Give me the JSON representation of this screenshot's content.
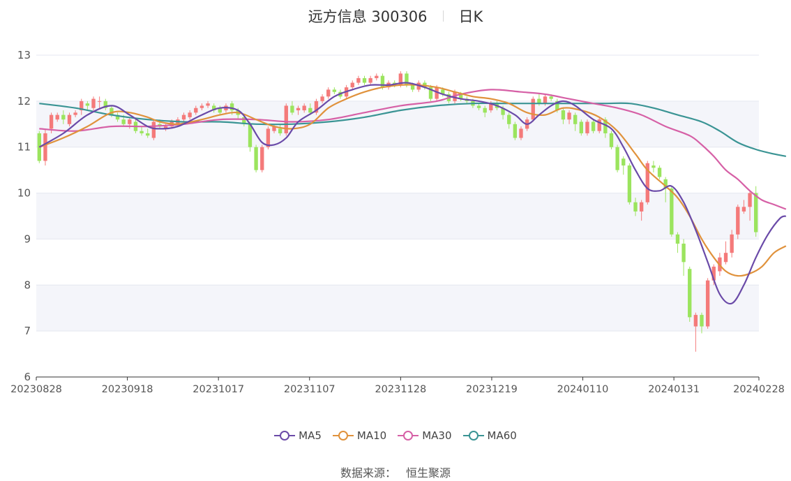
{
  "header": {
    "stock": "远方信息 300306",
    "period": "日K"
  },
  "source": {
    "label": "数据来源：",
    "value": "恒生聚源"
  },
  "colors": {
    "up": "#f47a7a",
    "down": "#9be45e",
    "ma5": "#6a4aa8",
    "ma10": "#e0923c",
    "ma30": "#d660a6",
    "ma60": "#3a9494",
    "grid_band": "#f4f5fa",
    "grid_line": "#e4e7f0"
  },
  "chart_data": {
    "type": "candlestick",
    "ylim": [
      6,
      13
    ],
    "yticks": [
      6,
      7,
      8,
      9,
      10,
      11,
      12,
      13
    ],
    "xticks": [
      "20230828",
      "20230918",
      "20231017",
      "20231107",
      "20231128",
      "20231219",
      "20240110",
      "20240131",
      "20240228"
    ],
    "xtick_index": [
      0,
      15,
      30,
      45,
      60,
      75,
      90,
      105,
      119
    ],
    "legend": [
      {
        "key": "ma5",
        "name": "MA5"
      },
      {
        "key": "ma10",
        "name": "MA10"
      },
      {
        "key": "ma30",
        "name": "MA30"
      },
      {
        "key": "ma60",
        "name": "MA60"
      }
    ],
    "candles": [
      [
        11.3,
        10.7,
        11.35,
        10.65
      ],
      [
        10.7,
        11.3,
        11.4,
        10.6
      ],
      [
        11.4,
        11.7,
        11.75,
        11.3
      ],
      [
        11.6,
        11.7,
        11.75,
        11.55
      ],
      [
        11.7,
        11.6,
        11.8,
        11.5
      ],
      [
        11.5,
        11.7,
        11.75,
        11.45
      ],
      [
        11.7,
        11.75,
        11.8,
        11.65
      ],
      [
        11.8,
        12.0,
        12.05,
        11.7
      ],
      [
        11.95,
        11.9,
        12.0,
        11.8
      ],
      [
        11.85,
        12.05,
        12.1,
        11.8
      ],
      [
        12.0,
        12.0,
        12.1,
        11.85
      ],
      [
        12.0,
        11.85,
        12.05,
        11.8
      ],
      [
        11.85,
        11.7,
        11.9,
        11.65
      ],
      [
        11.7,
        11.6,
        11.75,
        11.55
      ],
      [
        11.6,
        11.5,
        11.7,
        11.45
      ],
      [
        11.5,
        11.6,
        11.65,
        11.4
      ],
      [
        11.55,
        11.35,
        11.6,
        11.3
      ],
      [
        11.35,
        11.3,
        11.45,
        11.25
      ],
      [
        11.3,
        11.25,
        11.4,
        11.2
      ],
      [
        11.2,
        11.55,
        11.6,
        11.15
      ],
      [
        11.5,
        11.45,
        11.6,
        11.4
      ],
      [
        11.4,
        11.45,
        11.5,
        11.35
      ],
      [
        11.45,
        11.55,
        11.6,
        11.4
      ],
      [
        11.5,
        11.6,
        11.65,
        11.45
      ],
      [
        11.6,
        11.7,
        11.75,
        11.55
      ],
      [
        11.65,
        11.75,
        11.8,
        11.6
      ],
      [
        11.75,
        11.85,
        11.9,
        11.7
      ],
      [
        11.85,
        11.9,
        11.95,
        11.8
      ],
      [
        11.9,
        11.95,
        12.0,
        11.85
      ],
      [
        11.9,
        11.8,
        11.95,
        11.75
      ],
      [
        11.85,
        11.75,
        11.9,
        11.7
      ],
      [
        11.8,
        11.9,
        11.95,
        11.75
      ],
      [
        11.95,
        11.8,
        12.0,
        11.7
      ],
      [
        11.8,
        11.7,
        11.85,
        11.6
      ],
      [
        11.65,
        11.5,
        11.7,
        11.45
      ],
      [
        11.5,
        11.0,
        11.55,
        10.9
      ],
      [
        11.0,
        10.5,
        11.05,
        10.45
      ],
      [
        10.5,
        11.0,
        11.05,
        10.45
      ],
      [
        11.0,
        11.4,
        11.45,
        10.95
      ],
      [
        11.35,
        11.45,
        11.5,
        11.3
      ],
      [
        11.4,
        11.3,
        11.5,
        11.25
      ],
      [
        11.3,
        11.9,
        11.95,
        11.25
      ],
      [
        11.9,
        11.75,
        12.0,
        11.7
      ],
      [
        11.8,
        11.85,
        11.9,
        11.7
      ],
      [
        11.8,
        11.9,
        11.95,
        11.75
      ],
      [
        11.85,
        11.75,
        11.95,
        11.7
      ],
      [
        11.75,
        12.0,
        12.05,
        11.7
      ],
      [
        12.0,
        12.1,
        12.15,
        11.95
      ],
      [
        12.1,
        12.25,
        12.3,
        12.05
      ],
      [
        12.25,
        12.2,
        12.3,
        12.15
      ],
      [
        12.2,
        12.1,
        12.25,
        12.05
      ],
      [
        12.1,
        12.3,
        12.35,
        12.05
      ],
      [
        12.3,
        12.4,
        12.45,
        12.25
      ],
      [
        12.4,
        12.5,
        12.55,
        12.35
      ],
      [
        12.5,
        12.4,
        12.55,
        12.35
      ],
      [
        12.4,
        12.5,
        12.55,
        12.35
      ],
      [
        12.5,
        12.55,
        12.6,
        12.45
      ],
      [
        12.55,
        12.3,
        12.6,
        12.25
      ],
      [
        12.3,
        12.4,
        12.45,
        12.25
      ],
      [
        12.4,
        12.35,
        12.45,
        12.3
      ],
      [
        12.35,
        12.6,
        12.65,
        12.3
      ],
      [
        12.6,
        12.35,
        12.65,
        12.3
      ],
      [
        12.35,
        12.25,
        12.4,
        12.2
      ],
      [
        12.25,
        12.4,
        12.45,
        12.2
      ],
      [
        12.4,
        12.3,
        12.45,
        12.25
      ],
      [
        12.3,
        12.05,
        12.35,
        12.0
      ],
      [
        12.05,
        12.3,
        12.35,
        12.0
      ],
      [
        12.25,
        12.15,
        12.3,
        12.1
      ],
      [
        12.15,
        12.0,
        12.2,
        11.95
      ],
      [
        12.0,
        12.2,
        12.25,
        11.95
      ],
      [
        12.15,
        12.05,
        12.2,
        12.0
      ],
      [
        12.05,
        12.0,
        12.1,
        11.95
      ],
      [
        12.0,
        11.9,
        12.05,
        11.85
      ],
      [
        11.9,
        11.85,
        11.95,
        11.8
      ],
      [
        11.85,
        11.75,
        11.9,
        11.65
      ],
      [
        11.8,
        11.95,
        12.0,
        11.75
      ],
      [
        11.95,
        11.85,
        12.0,
        11.8
      ],
      [
        11.85,
        11.7,
        11.9,
        11.6
      ],
      [
        11.7,
        11.5,
        11.75,
        11.4
      ],
      [
        11.5,
        11.2,
        11.55,
        11.15
      ],
      [
        11.2,
        11.4,
        11.45,
        11.15
      ],
      [
        11.4,
        11.6,
        11.65,
        11.35
      ],
      [
        11.6,
        12.05,
        12.1,
        11.55
      ],
      [
        12.05,
        11.95,
        12.15,
        11.9
      ],
      [
        11.95,
        12.1,
        12.15,
        11.9
      ],
      [
        12.1,
        12.05,
        12.15,
        12.0
      ],
      [
        12.0,
        11.8,
        12.05,
        11.75
      ],
      [
        11.8,
        11.6,
        11.85,
        11.5
      ],
      [
        11.6,
        11.75,
        11.8,
        11.5
      ],
      [
        11.7,
        11.5,
        11.75,
        11.35
      ],
      [
        11.55,
        11.3,
        11.6,
        11.25
      ],
      [
        11.3,
        11.55,
        11.6,
        11.25
      ],
      [
        11.55,
        11.35,
        11.6,
        11.3
      ],
      [
        11.35,
        11.6,
        11.65,
        11.3
      ],
      [
        11.6,
        11.3,
        11.65,
        11.2
      ],
      [
        11.3,
        11.0,
        11.35,
        10.95
      ],
      [
        11.0,
        10.5,
        11.05,
        10.45
      ],
      [
        10.75,
        10.6,
        10.8,
        10.4
      ],
      [
        10.6,
        9.8,
        10.65,
        9.75
      ],
      [
        9.8,
        9.6,
        9.9,
        9.5
      ],
      [
        9.6,
        9.8,
        9.85,
        9.4
      ],
      [
        9.8,
        10.65,
        10.7,
        9.75
      ],
      [
        10.6,
        10.55,
        10.7,
        10.45
      ],
      [
        10.55,
        10.35,
        10.6,
        10.3
      ],
      [
        10.3,
        10.1,
        10.35,
        9.8
      ],
      [
        10.1,
        9.1,
        10.15,
        9.05
      ],
      [
        9.1,
        8.9,
        9.15,
        8.7
      ],
      [
        8.9,
        8.5,
        9.0,
        8.2
      ],
      [
        8.35,
        7.3,
        8.4,
        7.2
      ],
      [
        7.1,
        7.35,
        7.4,
        6.55
      ],
      [
        7.35,
        7.1,
        7.4,
        6.95
      ],
      [
        7.1,
        8.1,
        8.15,
        7.05
      ],
      [
        8.1,
        8.4,
        8.45,
        8.0
      ],
      [
        8.3,
        8.6,
        8.7,
        8.2
      ],
      [
        8.5,
        8.7,
        8.95,
        8.45
      ],
      [
        8.7,
        9.1,
        9.2,
        8.6
      ],
      [
        9.1,
        9.7,
        9.75,
        9.0
      ],
      [
        9.6,
        9.7,
        9.85,
        9.55
      ],
      [
        9.7,
        10.0,
        10.05,
        9.4
      ],
      [
        10.0,
        9.15,
        10.15,
        9.05
      ]
    ],
    "ma5": [
      [
        0,
        11.0
      ],
      [
        4,
        11.3
      ],
      [
        8,
        11.7
      ],
      [
        12,
        11.9
      ],
      [
        15,
        11.7
      ],
      [
        18,
        11.45
      ],
      [
        20,
        11.4
      ],
      [
        23,
        11.45
      ],
      [
        27,
        11.7
      ],
      [
        30,
        11.85
      ],
      [
        33,
        11.8
      ],
      [
        35,
        11.5
      ],
      [
        37,
        11.1
      ],
      [
        39,
        11.05
      ],
      [
        41,
        11.2
      ],
      [
        43,
        11.55
      ],
      [
        46,
        11.8
      ],
      [
        49,
        12.1
      ],
      [
        52,
        12.25
      ],
      [
        55,
        12.35
      ],
      [
        58,
        12.35
      ],
      [
        61,
        12.4
      ],
      [
        64,
        12.3
      ],
      [
        67,
        12.15
      ],
      [
        70,
        12.05
      ],
      [
        73,
        12.0
      ],
      [
        76,
        11.9
      ],
      [
        79,
        11.7
      ],
      [
        81,
        11.5
      ],
      [
        83,
        11.7
      ],
      [
        85,
        11.9
      ],
      [
        87,
        12.0
      ],
      [
        89,
        11.9
      ],
      [
        92,
        11.6
      ],
      [
        95,
        11.4
      ],
      [
        97,
        11.0
      ],
      [
        99,
        10.5
      ],
      [
        101,
        10.1
      ],
      [
        103,
        10.05
      ],
      [
        105,
        10.15
      ],
      [
        107,
        9.8
      ],
      [
        109,
        9.2
      ],
      [
        111,
        8.5
      ],
      [
        113,
        7.8
      ],
      [
        115,
        7.6
      ],
      [
        117,
        8.0
      ],
      [
        119,
        8.6
      ],
      [
        121,
        9.1
      ],
      [
        123,
        9.45
      ],
      [
        124,
        9.5
      ]
    ],
    "ma10": [
      [
        0,
        11.0
      ],
      [
        4,
        11.2
      ],
      [
        8,
        11.45
      ],
      [
        12,
        11.75
      ],
      [
        15,
        11.75
      ],
      [
        18,
        11.65
      ],
      [
        20,
        11.55
      ],
      [
        23,
        11.5
      ],
      [
        27,
        11.6
      ],
      [
        30,
        11.7
      ],
      [
        33,
        11.75
      ],
      [
        36,
        11.6
      ],
      [
        39,
        11.45
      ],
      [
        42,
        11.4
      ],
      [
        45,
        11.5
      ],
      [
        48,
        11.85
      ],
      [
        51,
        12.05
      ],
      [
        54,
        12.2
      ],
      [
        57,
        12.3
      ],
      [
        60,
        12.35
      ],
      [
        63,
        12.35
      ],
      [
        66,
        12.3
      ],
      [
        69,
        12.2
      ],
      [
        72,
        12.1
      ],
      [
        75,
        12.05
      ],
      [
        78,
        11.95
      ],
      [
        81,
        11.75
      ],
      [
        84,
        11.7
      ],
      [
        87,
        11.85
      ],
      [
        90,
        11.8
      ],
      [
        93,
        11.65
      ],
      [
        96,
        11.35
      ],
      [
        99,
        10.85
      ],
      [
        101,
        10.5
      ],
      [
        104,
        10.15
      ],
      [
        106,
        9.9
      ],
      [
        108,
        9.5
      ],
      [
        110,
        9.0
      ],
      [
        112,
        8.6
      ],
      [
        114,
        8.3
      ],
      [
        116,
        8.2
      ],
      [
        118,
        8.25
      ],
      [
        120,
        8.4
      ],
      [
        122,
        8.7
      ],
      [
        124,
        8.85
      ]
    ],
    "ma30": [
      [
        0,
        11.4
      ],
      [
        6,
        11.35
      ],
      [
        12,
        11.45
      ],
      [
        18,
        11.45
      ],
      [
        24,
        11.5
      ],
      [
        30,
        11.6
      ],
      [
        36,
        11.6
      ],
      [
        42,
        11.55
      ],
      [
        48,
        11.6
      ],
      [
        54,
        11.75
      ],
      [
        60,
        11.9
      ],
      [
        66,
        12.0
      ],
      [
        70,
        12.15
      ],
      [
        75,
        12.25
      ],
      [
        80,
        12.2
      ],
      [
        84,
        12.15
      ],
      [
        88,
        12.05
      ],
      [
        92,
        11.95
      ],
      [
        96,
        11.85
      ],
      [
        100,
        11.7
      ],
      [
        104,
        11.45
      ],
      [
        108,
        11.25
      ],
      [
        110,
        11.05
      ],
      [
        112,
        10.8
      ],
      [
        114,
        10.5
      ],
      [
        116,
        10.3
      ],
      [
        118,
        10.05
      ],
      [
        120,
        9.85
      ],
      [
        122,
        9.75
      ],
      [
        124,
        9.65
      ]
    ],
    "ma60": [
      [
        0,
        11.95
      ],
      [
        6,
        11.85
      ],
      [
        12,
        11.7
      ],
      [
        18,
        11.6
      ],
      [
        24,
        11.55
      ],
      [
        30,
        11.55
      ],
      [
        36,
        11.5
      ],
      [
        42,
        11.5
      ],
      [
        48,
        11.55
      ],
      [
        54,
        11.65
      ],
      [
        60,
        11.8
      ],
      [
        66,
        11.9
      ],
      [
        72,
        11.95
      ],
      [
        78,
        11.95
      ],
      [
        84,
        11.95
      ],
      [
        90,
        11.95
      ],
      [
        94,
        11.95
      ],
      [
        98,
        11.95
      ],
      [
        102,
        11.85
      ],
      [
        106,
        11.7
      ],
      [
        110,
        11.55
      ],
      [
        113,
        11.35
      ],
      [
        116,
        11.1
      ],
      [
        119,
        10.95
      ],
      [
        122,
        10.85
      ],
      [
        124,
        10.8
      ]
    ]
  }
}
